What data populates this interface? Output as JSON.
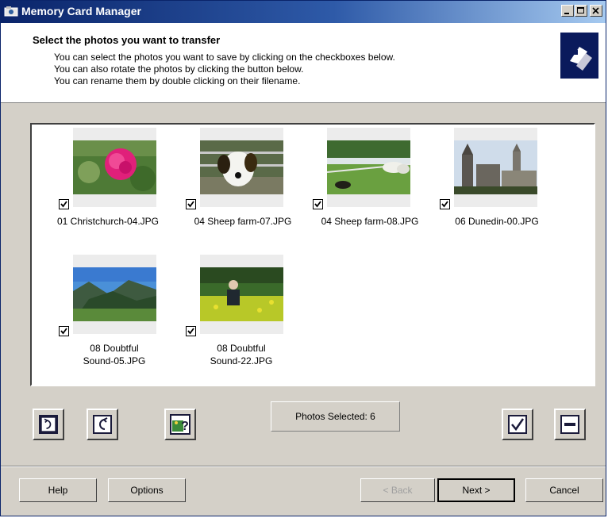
{
  "window": {
    "title": "Memory Card Manager"
  },
  "header": {
    "title": "Select the photos you want to transfer",
    "lines": [
      "You can select the photos you want to save by clicking on the checkboxes below.",
      "You can also rotate the photos by clicking the button below.",
      "You can rename them by double clicking on their filename."
    ]
  },
  "photos": [
    {
      "filename": "01 Christchurch-04.JPG",
      "checked": true
    },
    {
      "filename": "04 Sheep farm-07.JPG",
      "checked": true
    },
    {
      "filename": "04 Sheep farm-08.JPG",
      "checked": true
    },
    {
      "filename": "06 Dunedin-00.JPG",
      "checked": true
    },
    {
      "filename_line1": "08 Doubtful",
      "filename_line2": "Sound-05.JPG",
      "checked": true
    },
    {
      "filename_line1": "08 Doubtful",
      "filename_line2": "Sound-22.JPG",
      "checked": true
    }
  ],
  "toolbar": {
    "rotate_left_icon": "rotate-left-icon",
    "rotate_right_icon": "rotate-right-icon",
    "photo_info_icon": "photo-help-icon",
    "select_all_icon": "check-all-icon",
    "deselect_all_icon": "uncheck-all-icon"
  },
  "status": {
    "photos_selected": "Photos Selected: 6"
  },
  "buttons": {
    "help": "Help",
    "options": "Options",
    "back": "< Back",
    "next": "Next >",
    "cancel": "Cancel"
  }
}
